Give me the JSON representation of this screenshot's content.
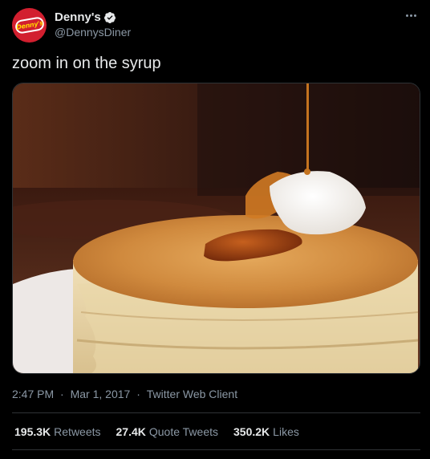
{
  "author": {
    "display_name": "Denny's",
    "handle": "@DennysDiner",
    "avatar_text": "Denny's",
    "verified": true
  },
  "tweet": {
    "text": "zoom in on the syrup",
    "time": "2:47 PM",
    "separator": "·",
    "date": "Mar 1, 2017",
    "client": "Twitter Web Client"
  },
  "stats": {
    "retweets": {
      "value": "195.3K",
      "label": "Retweets"
    },
    "quote_tweets": {
      "value": "27.4K",
      "label": "Quote Tweets"
    },
    "likes": {
      "value": "350.2K",
      "label": "Likes"
    }
  },
  "icons": {
    "verified": "verified-badge-icon",
    "more": "more-options-icon"
  },
  "colors": {
    "background": "#000000",
    "text_primary": "#e7e9ea",
    "text_secondary": "#8b98a5",
    "divider": "#2f3336",
    "brand_red": "#d21f2f",
    "brand_yellow": "#ffd400"
  }
}
